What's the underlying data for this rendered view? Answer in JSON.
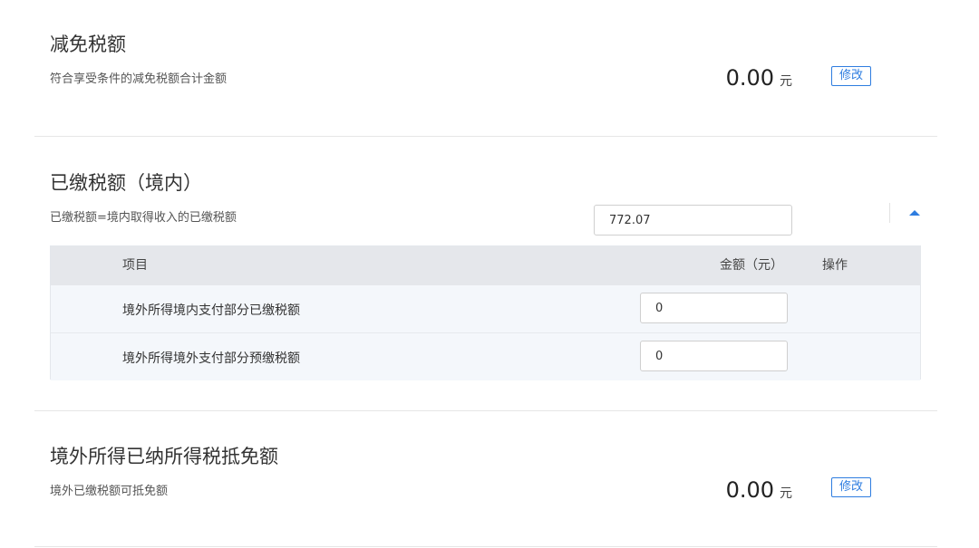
{
  "sections": {
    "reduction": {
      "title": "减免税额",
      "description": "符合享受条件的减免税额合计金额",
      "amount": "0.00",
      "unit": "元",
      "edit_label": "修改"
    },
    "domestic_paid": {
      "title": "已缴税额（境内）",
      "description": "已缴税额=境内取得收入的已缴税额",
      "total_value": "772.07",
      "collapse_icon": "caret-up-icon",
      "table": {
        "headers": {
          "item": "项目",
          "amount": "金额（元）",
          "action": "操作"
        },
        "rows": [
          {
            "label": "境外所得境内支付部分已缴税额",
            "value": "0"
          },
          {
            "label": "境外所得境外支付部分预缴税额",
            "value": "0"
          }
        ]
      }
    },
    "foreign_credit": {
      "title": "境外所得已纳所得税抵免额",
      "description": "境外已缴税额可抵免额",
      "amount": "0.00",
      "unit": "元",
      "edit_label": "修改"
    }
  },
  "colors": {
    "accent": "#2e7de0",
    "table_header_bg": "#e5e7eb",
    "table_row_bg": "#f4f7fb",
    "divider": "#e6e6e6"
  }
}
